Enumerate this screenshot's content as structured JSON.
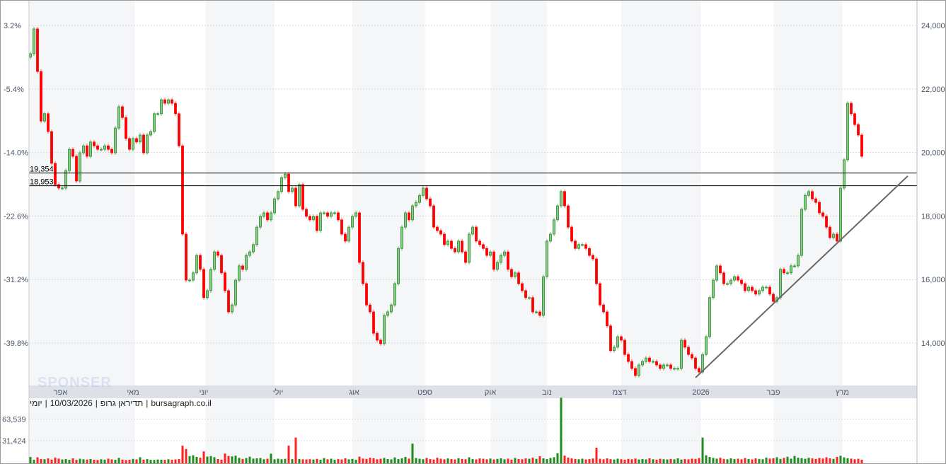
{
  "chart_data": {
    "type": "candlestick",
    "title": "תדיראן גרופ",
    "interval": "יומי",
    "date": "10/03/2026",
    "source": "bursagraph.co.il",
    "info_parts": [
      "יומי",
      "|",
      "10/03/2026",
      "|",
      "תדיראן גרופ",
      "|",
      "bursagraph.co.il"
    ],
    "watermark": "SPONSER",
    "price_axis": {
      "ylim": [
        12700,
        24700
      ],
      "ticks": [
        24000,
        22000,
        20000,
        18000,
        16000,
        14000
      ],
      "tick_labels": [
        "24,000",
        "22,000",
        "20,000",
        "18,000",
        "16,000",
        "14,000"
      ]
    },
    "percent_axis": {
      "tick_labels": [
        "3.2%",
        "-5.4%",
        "-14.0%",
        "-22.6%",
        "-31.2%",
        "-39.8%"
      ]
    },
    "volume_axis": {
      "ticks": [
        63539,
        31424
      ],
      "tick_labels": [
        "63,539",
        "31,424"
      ]
    },
    "months": [
      {
        "label": "אפר",
        "index": 8.5,
        "shaded": [
          -0.5,
          29.5
        ]
      },
      {
        "label": "מאי",
        "index": 29,
        "shaded": null
      },
      {
        "label": "יוני",
        "index": 49,
        "shaded": [
          49.5,
          69
        ]
      },
      {
        "label": "יולי",
        "index": 70,
        "shaded": null
      },
      {
        "label": "אוג",
        "index": 91.5,
        "shaded": [
          91,
          111.5
        ]
      },
      {
        "label": "ספט",
        "index": 111.5,
        "shaded": null
      },
      {
        "label": "אוק",
        "index": 130,
        "shaded": [
          130,
          146
        ]
      },
      {
        "label": "נוב",
        "index": 146,
        "shaded": null
      },
      {
        "label": "דצמ",
        "index": 166.5,
        "shaded": [
          167,
          189.5
        ]
      },
      {
        "label": "2026",
        "index": 189.5,
        "shaded": null
      },
      {
        "label": "פבר",
        "index": 210,
        "shaded": [
          210,
          229.5
        ]
      },
      {
        "label": "מרץ",
        "index": 229.5,
        "shaded": null
      }
    ],
    "levels": [
      {
        "value": 19354,
        "label": "19,354"
      },
      {
        "value": 18953,
        "label": "18,953"
      }
    ],
    "trendline": {
      "from": [
        188,
        12910
      ],
      "to": [
        248,
        19260
      ]
    },
    "first_open": 23000,
    "closes": [
      23110,
      23890,
      22550,
      20990,
      21220,
      20660,
      19660,
      18990,
      18880,
      18880,
      19430,
      20100,
      19880,
      19100,
      19990,
      20210,
      19880,
      20330,
      20210,
      20100,
      20100,
      20210,
      20100,
      19990,
      20770,
      21440,
      21100,
      20440,
      20100,
      20440,
      20330,
      20550,
      19990,
      20550,
      20660,
      21220,
      21220,
      21660,
      21550,
      21660,
      21550,
      21220,
      20210,
      17430,
      15980,
      15980,
      16210,
      16760,
      16320,
      15430,
      15650,
      16320,
      16870,
      16760,
      16210,
      15650,
      14980,
      15200,
      15980,
      16430,
      16320,
      16760,
      16870,
      17100,
      17650,
      17990,
      18100,
      17880,
      18100,
      18540,
      18770,
      19210,
      19320,
      18770,
      18880,
      18320,
      18990,
      18210,
      17990,
      17880,
      17990,
      17540,
      18100,
      18100,
      17990,
      18100,
      18100,
      17880,
      17430,
      17210,
      17650,
      17990,
      18100,
      16540,
      15870,
      15200,
      14980,
      14310,
      14090,
      13980,
      14870,
      14980,
      15200,
      15870,
      16980,
      17650,
      18100,
      17880,
      18320,
      18430,
      18650,
      18880,
      18540,
      18320,
      17650,
      17540,
      17430,
      17100,
      17210,
      16980,
      16870,
      17210,
      16870,
      16540,
      17430,
      17650,
      17210,
      17100,
      16980,
      16760,
      16870,
      16320,
      16540,
      16760,
      16870,
      16320,
      16090,
      16210,
      15870,
      15650,
      15430,
      15430,
      14980,
      14980,
      14870,
      16090,
      17210,
      17430,
      17880,
      18320,
      18770,
      18320,
      17650,
      17210,
      16980,
      17100,
      17100,
      16980,
      16760,
      16650,
      15870,
      15200,
      14980,
      14540,
      13760,
      13870,
      14200,
      14090,
      13640,
      13420,
      13200,
      12980,
      13310,
      13420,
      13530,
      13420,
      13420,
      13310,
      13200,
      13310,
      13310,
      13200,
      13200,
      13200,
      14090,
      13870,
      13640,
      13530,
      13200,
      13090,
      13640,
      14200,
      15430,
      15980,
      16430,
      16210,
      15870,
      15870,
      15980,
      16090,
      15980,
      15870,
      15650,
      15760,
      15650,
      15540,
      15650,
      15760,
      15760,
      15540,
      15310,
      15430,
      16320,
      16210,
      16210,
      16430,
      16430,
      16760,
      18210,
      18650,
      18770,
      18540,
      18430,
      18100,
      17990,
      17650,
      17320,
      17430,
      17210,
      18880,
      19770,
      21550,
      21220,
      20880,
      20550,
      19880
    ],
    "volumes": [
      7200,
      3100,
      6800,
      4200,
      3900,
      5100,
      3300,
      6400,
      4800,
      3500,
      4100,
      3000,
      5200,
      2900,
      4600,
      3800,
      3400,
      4200,
      3100,
      2700,
      3900,
      3200,
      4700,
      3600,
      3000,
      5800,
      3300,
      2600,
      3100,
      4400,
      3700,
      6900,
      3300,
      4100,
      3000,
      2800,
      3500,
      3200,
      2900,
      3800,
      3100,
      3600,
      4200,
      24000,
      19000,
      8500,
      9800,
      7400,
      6200,
      15500,
      7800,
      8600,
      6900,
      4200,
      3300,
      12300,
      8800,
      8100,
      9200,
      5900,
      4300,
      5600,
      7700,
      4800,
      5200,
      5600,
      3900,
      4600,
      12100,
      3800,
      4700,
      3900,
      4500,
      24000,
      4100,
      36000,
      4300,
      3800,
      3600,
      4000,
      3500,
      4400,
      3200,
      5600,
      3900,
      4700,
      3000,
      4100,
      3600,
      5200,
      3800,
      4400,
      3100,
      7700,
      4900,
      4300,
      6100,
      5300,
      3900,
      4600,
      5800,
      4200,
      3700,
      6600,
      4100,
      5200,
      7300,
      4800,
      27000,
      5600,
      4600,
      3900,
      5800,
      4100,
      3500,
      6200,
      4700,
      3800,
      5100,
      4200,
      3600,
      5400,
      4300,
      3900,
      6800,
      4100,
      3700,
      5100,
      4600,
      3800,
      4900,
      3600,
      4400,
      5200,
      3700,
      4800,
      3300,
      5700,
      4200,
      3900,
      5100,
      4600,
      6200,
      4400,
      8300,
      5200,
      4100,
      5800,
      6900,
      12800,
      95000,
      9200,
      6400,
      5100,
      4300,
      3900,
      4700,
      3600,
      4200,
      5000,
      21000,
      4600,
      3800,
      5200,
      4100,
      3500,
      4700,
      3900,
      3300,
      4400,
      3800,
      4900,
      3500,
      4200,
      3700,
      5300,
      3900,
      3200,
      4600,
      4000,
      3600,
      4300,
      3800,
      5200,
      3400,
      4100,
      3700,
      4800,
      4400,
      5600,
      36000,
      9800,
      7200,
      5900,
      4800,
      6100,
      4400,
      3900,
      5200,
      4100,
      4700,
      3800,
      5600,
      4200,
      3600,
      5100,
      4400,
      3900,
      6400,
      4800,
      5300,
      6900,
      4400,
      5800,
      7600,
      4700,
      8800,
      6100,
      5400,
      4600,
      6200,
      5100,
      4300,
      5700,
      4900,
      6800,
      5200,
      4400,
      7300,
      9100,
      6700,
      5400,
      4800,
      3900,
      4600,
      3200
    ],
    "colors": {
      "up": "#1e8c1e",
      "up_fill": "#8cc88c",
      "down": "#ff0000",
      "shade": "#f5f6f8",
      "axis_bar": "#dde1e7",
      "trend": "#666666"
    }
  }
}
